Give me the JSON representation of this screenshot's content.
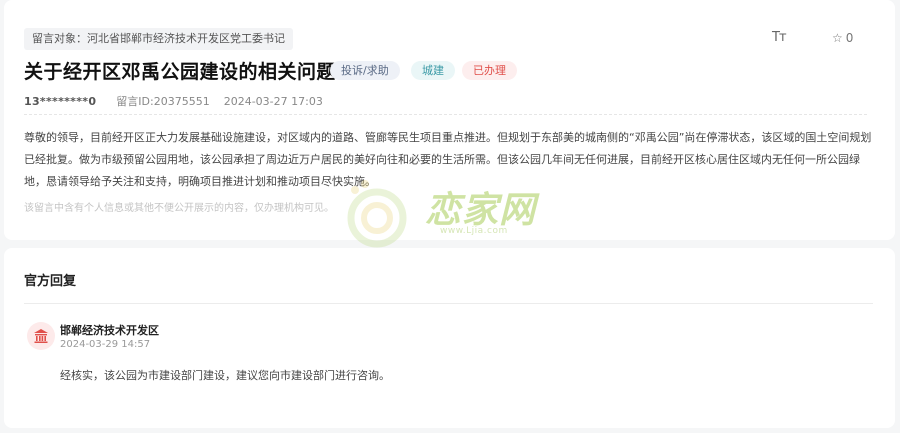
{
  "message": {
    "target_label": "留言对象：河北省邯郸市经济技术开发区党工委书记",
    "title": "关于经开区邓禹公园建设的相关问题",
    "tags": {
      "type": "投诉/求助",
      "category": "城建",
      "status": "已办理"
    },
    "tag_colors": {
      "type_bg": "#eef1f7",
      "category_bg": "#eaf6f7",
      "status_bg": "#fdeeee",
      "status_text": "#e0504b"
    },
    "toolbar": {
      "font_size_icon": "Tт",
      "star_icon": "☆",
      "star_count": "0"
    },
    "phone": "13********0",
    "message_id": "留言ID:20375551",
    "time": "2024-03-27 17:03",
    "body": "尊敬的领导，目前经开区正大力发展基础设施建设，对区域内的道路、管廊等民生项目重点推进。但规划于东部美的城南侧的“邓禹公园”尚在停滞状态，该区域的国土空间规划已经批复。做为市级预留公园用地，该公园承担了周边近万户居民的美好向往和必要的生活所需。但该公园几年间无任何进展，目前经开区核心居住区域内无任何一所公园绿地，恳请领导给予关注和支持，明确项目推进计划和推动项目尽快实施。",
    "privacy_notice": "该留言中含有个人信息或其他不便公开展示的内容，仅办理机构可见。"
  },
  "watermark": {
    "text": "恋家网",
    "url": "www.Ljia.com"
  },
  "reply": {
    "heading": "官方回复",
    "org_icon": "government-building-icon",
    "org_name": "邯郸经济技术开发区",
    "date": "2024-03-29 14:57",
    "content": "经核实，该公园为市建设部门建设，建议您向市建设部门进行咨询。",
    "accent_color": "#e0504b"
  }
}
